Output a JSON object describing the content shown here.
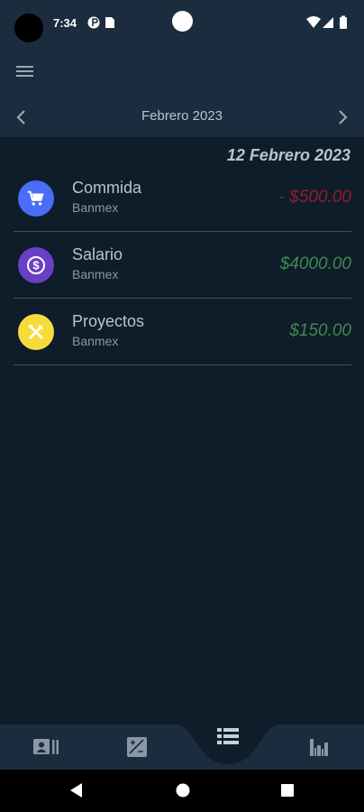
{
  "status_bar": {
    "time": "7:34",
    "icons_left": [
      "data-saver-icon",
      "sim-card-icon"
    ],
    "icons_right": [
      "wifi-icon",
      "signal-icon",
      "battery-icon"
    ]
  },
  "app_bar": {
    "menu_icon": "hamburger-menu-icon"
  },
  "month_nav": {
    "label": "Febrero 2023",
    "prev_icon": "chevron-left-icon",
    "next_icon": "chevron-right-icon"
  },
  "day_header": "12 Febrero 2023",
  "transactions": [
    {
      "title": "Commida",
      "account": "Banmex",
      "amount": "- $500.00",
      "icon": "cart-icon",
      "icon_color": "#4a6cf7",
      "amount_color": "#8f1d33"
    },
    {
      "title": "Salario",
      "account": "Banmex",
      "amount": "$4000.00",
      "icon": "dollar-coin-icon",
      "icon_color": "#6a3fc4",
      "amount_color": "#3e8a4f"
    },
    {
      "title": "Proyectos",
      "account": "Banmex",
      "amount": "$150.00",
      "icon": "tools-icon",
      "icon_color": "#f5dc3a",
      "amount_color": "#3e8a4f"
    }
  ],
  "bottom_nav": {
    "items": [
      "accounts-icon",
      "calculator-icon",
      "transactions-list-icon",
      "stats-bar-chart-icon"
    ],
    "selected": "transactions-list-icon"
  },
  "system_nav": [
    "back-icon",
    "home-icon",
    "recents-icon"
  ],
  "colors": {
    "background": "#0f1c29",
    "bar": "#1a2c3d",
    "text_primary": "#b9c4d0",
    "expense": "#8f1d33",
    "income": "#3e8a4f"
  }
}
